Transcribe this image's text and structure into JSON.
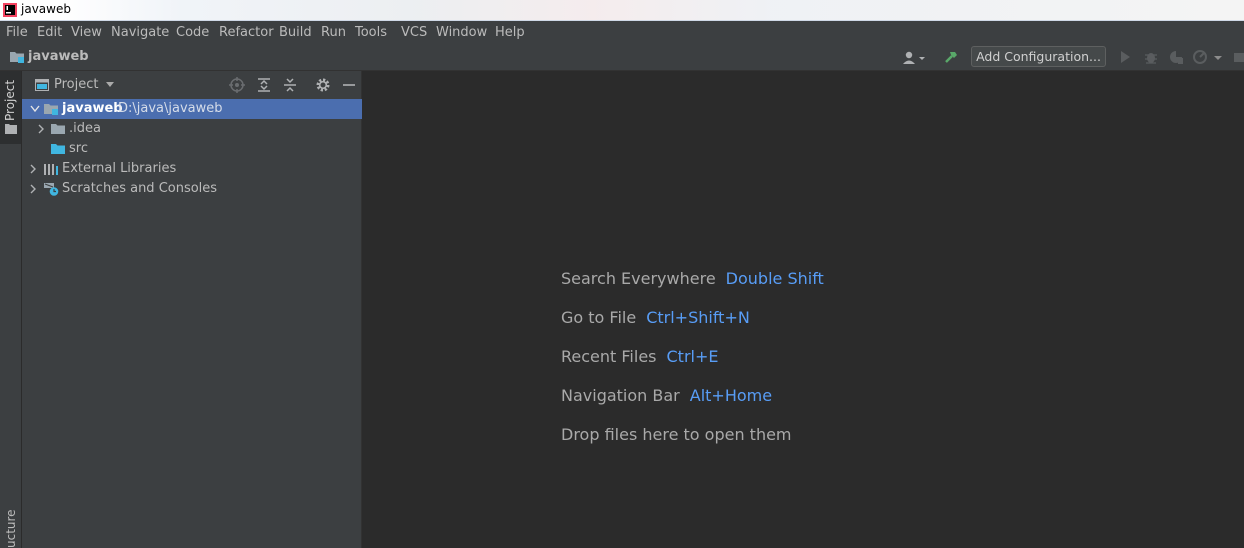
{
  "window": {
    "title": "javaweb"
  },
  "menu": [
    "File",
    "Edit",
    "View",
    "Navigate",
    "Code",
    "Refactor",
    "Build",
    "Run",
    "Tools",
    "VCS",
    "Window",
    "Help"
  ],
  "navbar": {
    "project": "javaweb",
    "add_configuration": "Add Configuration..."
  },
  "tool_window_tabs": {
    "left_top": "Project",
    "left_bottom": "ucture"
  },
  "project_panel": {
    "title": "Project",
    "tree": [
      {
        "label": "javaweb",
        "path": "D:\\java\\javaweb",
        "icon": "module-folder-icon",
        "expanded": true,
        "selected": true
      },
      {
        "label": ".idea",
        "icon": "folder-icon",
        "expanded": false
      },
      {
        "label": "src",
        "icon": "source-folder-icon"
      },
      {
        "label": "External Libraries",
        "icon": "libraries-icon",
        "expanded": false
      },
      {
        "label": "Scratches and Consoles",
        "icon": "scratches-icon",
        "expanded": false
      }
    ]
  },
  "editor_hints": [
    {
      "action": "Search Everywhere",
      "shortcut": "Double Shift"
    },
    {
      "action": "Go to File",
      "shortcut": "Ctrl+Shift+N"
    },
    {
      "action": "Recent Files",
      "shortcut": "Ctrl+E"
    },
    {
      "action": "Navigation Bar",
      "shortcut": "Alt+Home"
    },
    {
      "action": "Drop files here to open them",
      "shortcut": ""
    }
  ],
  "colors": {
    "background": "#2b2b2b",
    "panel": "#3c3f41",
    "selection": "#4b6eaf",
    "shortcut": "#589df6",
    "build_hammer": "#59a869"
  }
}
